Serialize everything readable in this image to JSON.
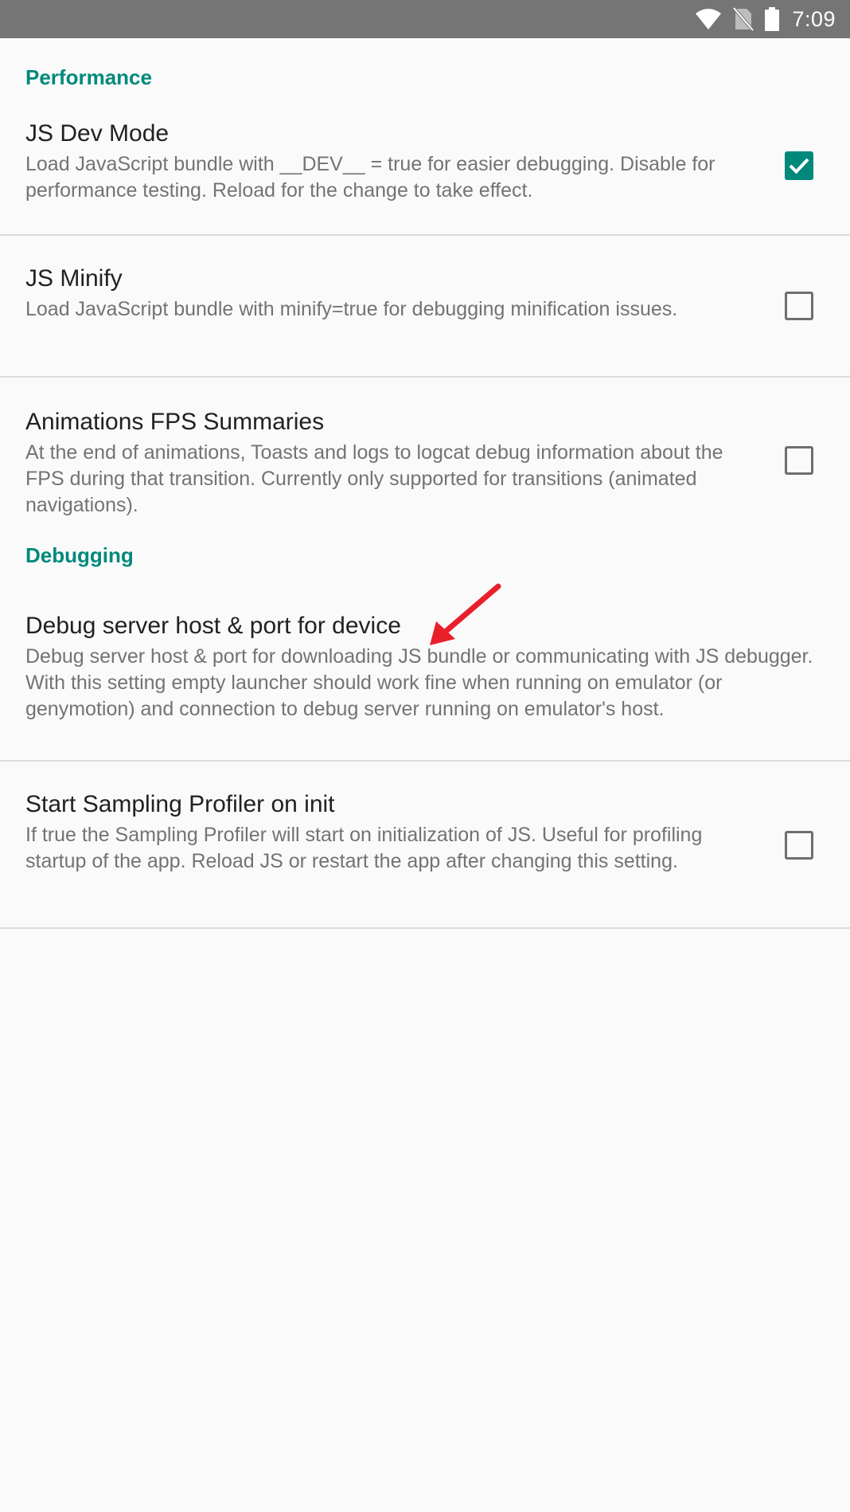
{
  "status_bar": {
    "time": "7:09",
    "icons": [
      "wifi-icon",
      "no-sim-icon",
      "battery-icon"
    ]
  },
  "sections": {
    "performance": {
      "header": "Performance",
      "items": [
        {
          "title": "JS Dev Mode",
          "summary": "Load JavaScript bundle with __DEV__ = true for easier debugging. Disable for performance testing. Reload for the change to take effect.",
          "checked": true
        },
        {
          "title": "JS Minify",
          "summary": "Load JavaScript bundle with minify=true for debugging minification issues.",
          "checked": false
        },
        {
          "title": "Animations FPS Summaries",
          "summary": "At the end of animations, Toasts and logs to logcat debug information about the FPS during that transition. Currently only supported for transitions (animated navigations).",
          "checked": false
        }
      ]
    },
    "debugging": {
      "header": "Debugging",
      "items": [
        {
          "title": "Debug server host & port for device",
          "summary": "Debug server host & port for downloading JS bundle or communicating with JS debugger. With this setting empty launcher should work fine when running on emulator (or genymotion) and connection to debug server running on emulator's host."
        },
        {
          "title": "Start Sampling Profiler on init",
          "summary": "If true the Sampling Profiler will start on initialization of JS. Useful for profiling startup of the app. Reload JS or restart the app after changing this setting.",
          "checked": false
        }
      ]
    }
  },
  "colors": {
    "status_bar": "#757575",
    "accent": "#00897b",
    "background": "#fafafa",
    "annotation_arrow": "#e8202a"
  }
}
